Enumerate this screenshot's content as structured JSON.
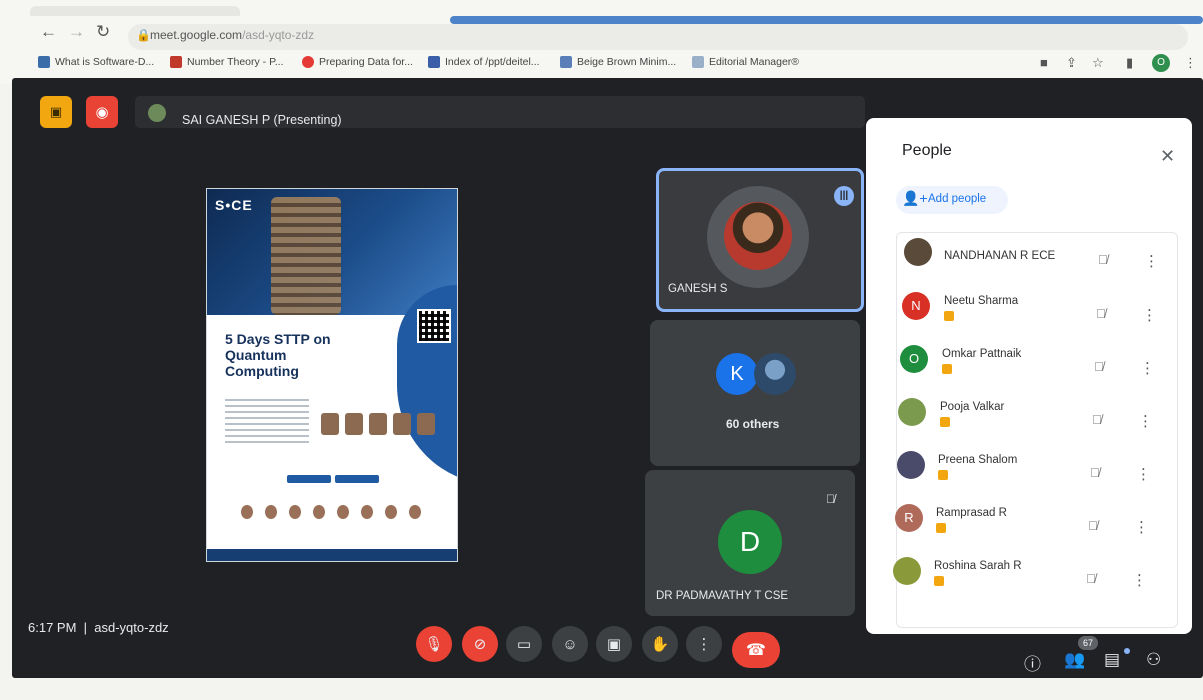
{
  "browser": {
    "url_host": "meet.google.com",
    "url_path": "/asd-yqto-zdz",
    "bookmarks": [
      "What is Software-D...",
      "Number Theory - P...",
      "Preparing Data for...",
      "Index of /ppt/deitel...",
      "Beige Brown Minim...",
      "Editorial Manager®"
    ],
    "profile_initial": "O"
  },
  "meet": {
    "presenting_label": "SAI GANESH P (Presenting)",
    "poster": {
      "logo": "S•CE",
      "title": "5 Days STTP on Quantum Computing"
    },
    "tiles": {
      "ganesh_name": "GANESH S",
      "others_initial": "K",
      "others_label": "60 others",
      "padma_initial": "D",
      "padma_name": "DR PADMAVATHY T CSE"
    },
    "clock": "6:17 PM",
    "meeting_code": "asd-yqto-zdz",
    "participants_count": "67"
  },
  "people_panel": {
    "title": "People",
    "add_people": "Add people",
    "people": [
      {
        "name": "NANDHANAN R ECE",
        "initial": "",
        "color": "#5a4a3a"
      },
      {
        "name": "Neetu Sharma",
        "initial": "N",
        "color": "#d93025"
      },
      {
        "name": "Omkar Pattnaik",
        "initial": "O",
        "color": "#1e8e3e"
      },
      {
        "name": "Pooja Valkar",
        "initial": "",
        "color": "#7c9a4e"
      },
      {
        "name": "Preena Shalom",
        "initial": "",
        "color": "#4a4a6a"
      },
      {
        "name": "Ramprasad R",
        "initial": "R",
        "color": "#b06a5a"
      },
      {
        "name": "Roshina Sarah R",
        "initial": "",
        "color": "#8a9a3a"
      }
    ]
  }
}
